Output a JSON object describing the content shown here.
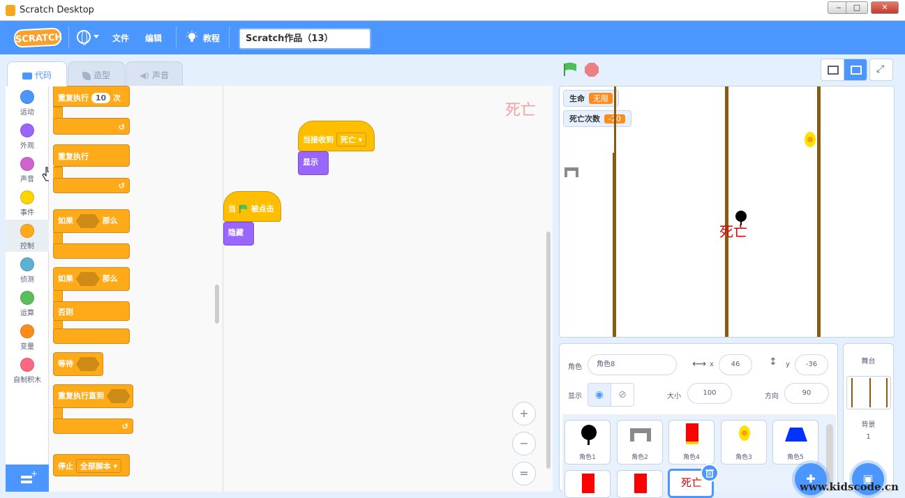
{
  "window": {
    "title": "Scratch Desktop",
    "min": "‒",
    "max": "□",
    "close": "✕"
  },
  "menu": {
    "logo": "SCRATCH",
    "file": "文件",
    "edit": "编辑",
    "tutorials": "教程",
    "project_title": "Scratch作品（13）"
  },
  "tabs": [
    {
      "label": "代码"
    },
    {
      "label": "造型"
    },
    {
      "label": "声音"
    }
  ],
  "categories": [
    {
      "label": "运动",
      "color": "#4c97ff"
    },
    {
      "label": "外观",
      "color": "#9966ff"
    },
    {
      "label": "声音",
      "color": "#cf63cf"
    },
    {
      "label": "事件",
      "color": "#ffd500"
    },
    {
      "label": "控制",
      "color": "#ffab19"
    },
    {
      "label": "侦测",
      "color": "#5cb1d6"
    },
    {
      "label": "运算",
      "color": "#59c059"
    },
    {
      "label": "变量",
      "color": "#ff8c1a"
    },
    {
      "label": "自制积木",
      "color": "#ff6680"
    }
  ],
  "palette": {
    "repeat": "重复执行",
    "repeat_count": "10",
    "repeat_times": "次",
    "forever": "重复执行",
    "if": "如果",
    "then": "那么",
    "if2": "如果",
    "then2": "那么",
    "else": "否则",
    "wait": "等待",
    "repeat_until": "重复执行直到",
    "stop": "停止",
    "stop_option": "全部脚本"
  },
  "scripts": {
    "sprite_name_watermark": "死亡",
    "hat1": "当接收到",
    "hat1_message": "死亡",
    "show": "显示",
    "hat2_pre": "当",
    "hat2_post": "被点击",
    "hide": "隐藏"
  },
  "zoom": {
    "in": "+",
    "out": "−",
    "reset": "="
  },
  "stage": {
    "monitors": [
      {
        "label": "生命",
        "value": "无限"
      },
      {
        "label": "死亡次数",
        "value": "-20"
      }
    ],
    "death_text": "死亡"
  },
  "sprite_info": {
    "sprite_label": "角色",
    "sprite_name": "角色8",
    "x_label": "x",
    "x": "46",
    "y_label": "y",
    "y": "-36",
    "show_label": "显示",
    "size_label": "大小",
    "size": "100",
    "direction_label": "方向",
    "direction": "90"
  },
  "sprites": [
    {
      "name": "角色1"
    },
    {
      "name": "角色2"
    },
    {
      "name": "角色4"
    },
    {
      "name": "角色3"
    },
    {
      "name": "角色5"
    }
  ],
  "selected_sprite_text": "死亡",
  "stage_panel": {
    "title": "舞台",
    "backdrops_label": "背景",
    "backdrops_count": "1"
  },
  "watermark": "www.kidscode.cn"
}
